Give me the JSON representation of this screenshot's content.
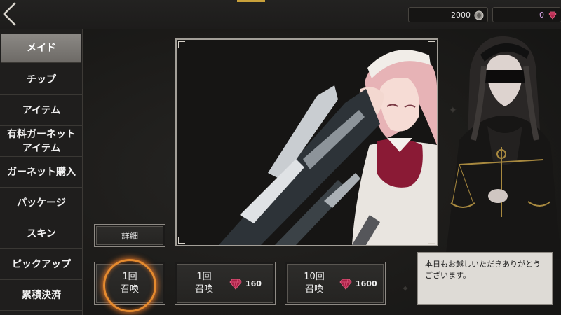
{
  "header": {
    "coins": "2000",
    "garnets": "0",
    "coin_icon": "coin-icon",
    "gem_icon": "garnet-icon"
  },
  "menu": {
    "items": [
      {
        "label": "メイド",
        "active": true
      },
      {
        "label": "チップ"
      },
      {
        "label": "アイテム"
      },
      {
        "label": "有料ガーネット\nアイテム"
      },
      {
        "label": "ガーネット購入"
      },
      {
        "label": "パッケージ"
      },
      {
        "label": "スキン"
      },
      {
        "label": "ピックアップ"
      },
      {
        "label": "累積決済"
      }
    ]
  },
  "main": {
    "detail_label": "詳細",
    "summon_free": {
      "label": "1回\n召喚"
    },
    "summon_one": {
      "label": "1回\n召喚",
      "cost": "160"
    },
    "summon_ten": {
      "label": "10回\n召喚",
      "cost": "1600"
    }
  },
  "dialog": {
    "text": "本日もお越しいただきありがとうございます。"
  },
  "colors": {
    "accent_orange": "#e58a2e",
    "garnet": "#b0244a",
    "active_tab": "#7c7975"
  }
}
